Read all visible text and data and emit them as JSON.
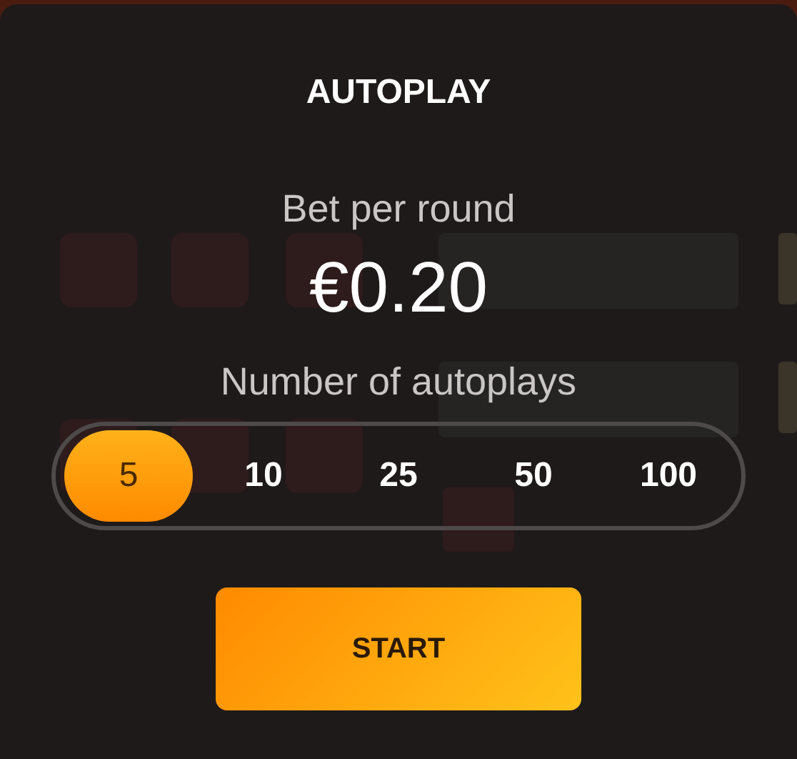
{
  "title": "AUTOPLAY",
  "bet": {
    "label": "Bet per round",
    "value": "€0.20"
  },
  "autoplays": {
    "label": "Number of autoplays",
    "options": [
      {
        "label": "5",
        "selected": true
      },
      {
        "label": "10",
        "selected": false
      },
      {
        "label": "25",
        "selected": false
      },
      {
        "label": "50",
        "selected": false
      },
      {
        "label": "100",
        "selected": false
      }
    ]
  },
  "start_button": "START"
}
